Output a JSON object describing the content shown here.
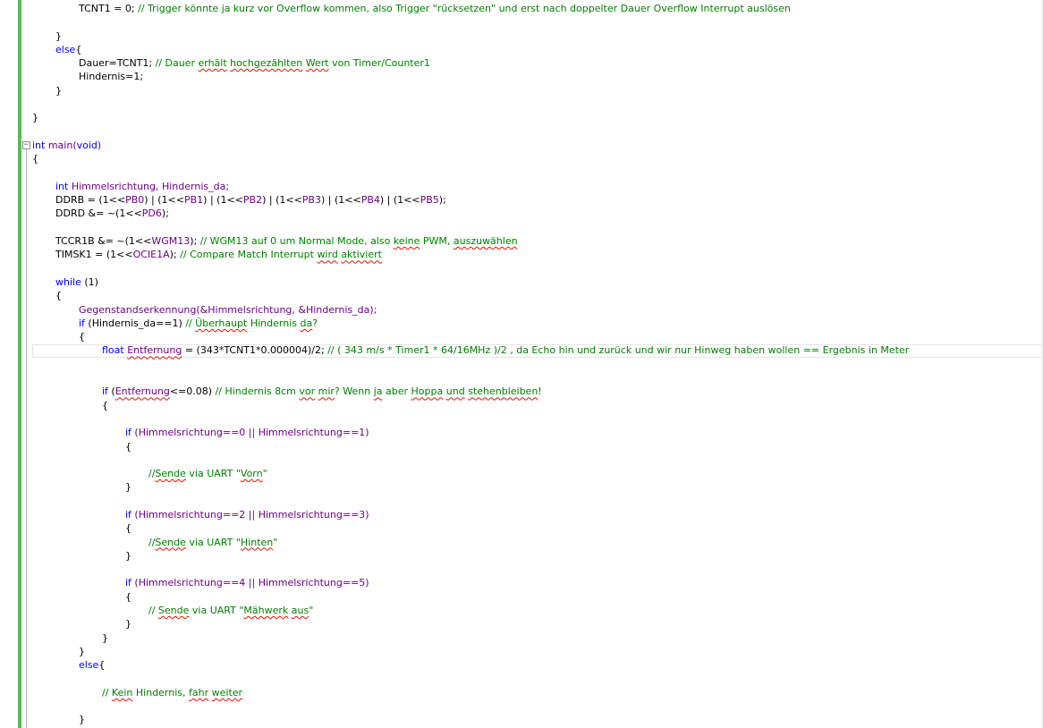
{
  "editor": {
    "collapse_glyph": "−",
    "colors": {
      "keyword": "#0000ff",
      "comment": "#008000",
      "macro": "#6f008a",
      "text": "#000000",
      "change_bar": "#5cb85c",
      "squiggle": "#e51400"
    },
    "current_line_index": 25,
    "lines": [
      {
        "indent": 4,
        "tokens": [
          {
            "t": "TCNT1 = 0; "
          },
          {
            "t": "// Trigger könnte ja kurz vor Overflow kommen, also Trigger \"rücksetzen\" und erst nach doppelter Dauer Overflow Interrupt auslösen",
            "c": "c"
          }
        ]
      },
      {
        "indent": 0,
        "tokens": []
      },
      {
        "indent": 2,
        "tokens": [
          {
            "t": "}"
          }
        ]
      },
      {
        "indent": 2,
        "tokens": [
          {
            "t": "else",
            "c": "k"
          },
          {
            "t": "{"
          }
        ]
      },
      {
        "indent": 4,
        "tokens": [
          {
            "t": "Dauer=TCNT1; "
          },
          {
            "t": "// Dauer ",
            "c": "c"
          },
          {
            "t": "erhält",
            "c": "c",
            "sq": true
          },
          {
            "t": " ",
            "c": "c"
          },
          {
            "t": "hochgezählten",
            "c": "c",
            "sq": true
          },
          {
            "t": " ",
            "c": "c"
          },
          {
            "t": "Wert",
            "c": "c",
            "sq": true
          },
          {
            "t": " von Timer/Counter1",
            "c": "c"
          }
        ]
      },
      {
        "indent": 4,
        "tokens": [
          {
            "t": "Hindernis=1;"
          }
        ]
      },
      {
        "indent": 2,
        "tokens": [
          {
            "t": "}"
          }
        ]
      },
      {
        "indent": 0,
        "tokens": []
      },
      {
        "indent": 0,
        "tokens": [
          {
            "t": "}"
          }
        ]
      },
      {
        "indent": 0,
        "tokens": []
      },
      {
        "indent": 0,
        "tokens": [
          {
            "t": "int",
            "c": "k"
          },
          {
            "t": " main(",
            "c": "m"
          },
          {
            "t": "void",
            "c": "k"
          },
          {
            "t": ")",
            "c": "m"
          }
        ]
      },
      {
        "indent": 0,
        "tokens": [
          {
            "t": "{"
          }
        ]
      },
      {
        "indent": 0,
        "tokens": []
      },
      {
        "indent": 2,
        "tokens": [
          {
            "t": "int",
            "c": "k"
          },
          {
            "t": " Himmelsrichtung, Hindernis_da;",
            "c": "m"
          }
        ]
      },
      {
        "indent": 2,
        "tokens": [
          {
            "t": "DDRB = (1<<"
          },
          {
            "t": "PB0",
            "c": "m"
          },
          {
            "t": ") | (1<<"
          },
          {
            "t": "PB1",
            "c": "m"
          },
          {
            "t": ") | (1<<"
          },
          {
            "t": "PB2",
            "c": "m"
          },
          {
            "t": ") | (1<<"
          },
          {
            "t": "PB3",
            "c": "m"
          },
          {
            "t": ") | (1<<"
          },
          {
            "t": "PB4",
            "c": "m"
          },
          {
            "t": ") | (1<<"
          },
          {
            "t": "PB5",
            "c": "m"
          },
          {
            "t": ");"
          }
        ]
      },
      {
        "indent": 2,
        "tokens": [
          {
            "t": "DDRD &= ~(1<<"
          },
          {
            "t": "PD6",
            "c": "m"
          },
          {
            "t": ");"
          }
        ]
      },
      {
        "indent": 0,
        "tokens": []
      },
      {
        "indent": 2,
        "tokens": [
          {
            "t": "TCCR1B &= ~(1<<"
          },
          {
            "t": "WGM13",
            "c": "m"
          },
          {
            "t": "); "
          },
          {
            "t": "// WGM13 auf 0 um Normal Mode, also ",
            "c": "c"
          },
          {
            "t": "keine",
            "c": "c",
            "sq": true
          },
          {
            "t": " PWM, ",
            "c": "c"
          },
          {
            "t": "auszuwählen",
            "c": "c",
            "sq": true
          }
        ]
      },
      {
        "indent": 2,
        "tokens": [
          {
            "t": "TIMSK1 = (1<<"
          },
          {
            "t": "OCIE1A",
            "c": "m"
          },
          {
            "t": "); "
          },
          {
            "t": "// Compare Match Interrupt ",
            "c": "c"
          },
          {
            "t": "wird",
            "c": "c",
            "sq": true
          },
          {
            "t": " ",
            "c": "c"
          },
          {
            "t": "aktiviert",
            "c": "c",
            "sq": true
          }
        ]
      },
      {
        "indent": 0,
        "tokens": []
      },
      {
        "indent": 2,
        "tokens": [
          {
            "t": "while",
            "c": "k"
          },
          {
            "t": " (1)"
          }
        ]
      },
      {
        "indent": 2,
        "tokens": [
          {
            "t": "{"
          }
        ]
      },
      {
        "indent": 4,
        "tokens": [
          {
            "t": "Gegenstandserkennung(&Himmelsrichtung, &Hindernis_da);",
            "c": "m"
          }
        ]
      },
      {
        "indent": 4,
        "tokens": [
          {
            "t": "if",
            "c": "k"
          },
          {
            "t": " (Hindernis_da==1) "
          },
          {
            "t": "// ",
            "c": "c"
          },
          {
            "t": "Überhaupt",
            "c": "c",
            "sq": true
          },
          {
            "t": " Hindernis ",
            "c": "c"
          },
          {
            "t": "da",
            "c": "c",
            "sq": true
          },
          {
            "t": "?",
            "c": "c"
          }
        ]
      },
      {
        "indent": 4,
        "tokens": [
          {
            "t": "{"
          }
        ]
      },
      {
        "indent": 6,
        "tokens": [
          {
            "t": "float",
            "c": "k"
          },
          {
            "t": " "
          },
          {
            "t": "Entfernung",
            "c": "m",
            "sq": true
          },
          {
            "t": " = (343*TCNT1*0.000004)/2; "
          },
          {
            "t": "// ( 343 m/s * Timer1 * 64/16MHz )/2 , da Echo hin und zurück und wir nur Hinweg haben wollen == Ergebnis in Meter",
            "c": "c"
          }
        ]
      },
      {
        "indent": 0,
        "tokens": []
      },
      {
        "indent": 0,
        "tokens": []
      },
      {
        "indent": 6,
        "tokens": [
          {
            "t": "if",
            "c": "k"
          },
          {
            "t": " ("
          },
          {
            "t": "Entfernung",
            "c": "m",
            "sq": true
          },
          {
            "t": "<=0.08) "
          },
          {
            "t": "// Hindernis 8cm ",
            "c": "c"
          },
          {
            "t": "vor",
            "c": "c",
            "sq": true
          },
          {
            "t": " ",
            "c": "c"
          },
          {
            "t": "mir",
            "c": "c",
            "sq": true
          },
          {
            "t": "? Wenn ",
            "c": "c"
          },
          {
            "t": "ja",
            "c": "c",
            "sq": true
          },
          {
            "t": " aber ",
            "c": "c"
          },
          {
            "t": "Hoppa",
            "c": "c",
            "sq": true
          },
          {
            "t": " ",
            "c": "c"
          },
          {
            "t": "und",
            "c": "c",
            "sq": true
          },
          {
            "t": " ",
            "c": "c"
          },
          {
            "t": "stehenbleiben",
            "c": "c",
            "sq": true
          },
          {
            "t": "!",
            "c": "c"
          }
        ]
      },
      {
        "indent": 6,
        "tokens": [
          {
            "t": "{"
          }
        ]
      },
      {
        "indent": 0,
        "tokens": []
      },
      {
        "indent": 8,
        "tokens": [
          {
            "t": "if",
            "c": "k"
          },
          {
            "t": " (Himmelsrichtung==0 || Himmelsrichtung==1)",
            "c": "m"
          }
        ]
      },
      {
        "indent": 8,
        "tokens": [
          {
            "t": "{"
          }
        ]
      },
      {
        "indent": 0,
        "tokens": []
      },
      {
        "indent": 10,
        "tokens": [
          {
            "t": "//",
            "c": "c"
          },
          {
            "t": "Sende",
            "c": "c",
            "sq": true
          },
          {
            "t": " via UART \"",
            "c": "c"
          },
          {
            "t": "Vorn",
            "c": "c",
            "sq": true
          },
          {
            "t": "\"",
            "c": "c"
          }
        ]
      },
      {
        "indent": 8,
        "tokens": [
          {
            "t": "}"
          }
        ]
      },
      {
        "indent": 0,
        "tokens": []
      },
      {
        "indent": 8,
        "tokens": [
          {
            "t": "if",
            "c": "k"
          },
          {
            "t": " (Himmelsrichtung==2 || Himmelsrichtung==3)",
            "c": "m"
          }
        ]
      },
      {
        "indent": 8,
        "tokens": [
          {
            "t": "{"
          }
        ]
      },
      {
        "indent": 10,
        "tokens": [
          {
            "t": "//",
            "c": "c"
          },
          {
            "t": "Sende",
            "c": "c",
            "sq": true
          },
          {
            "t": " via UART \"",
            "c": "c"
          },
          {
            "t": "Hinten",
            "c": "c",
            "sq": true
          },
          {
            "t": "\"",
            "c": "c"
          }
        ]
      },
      {
        "indent": 8,
        "tokens": [
          {
            "t": "}"
          }
        ]
      },
      {
        "indent": 0,
        "tokens": []
      },
      {
        "indent": 8,
        "tokens": [
          {
            "t": "if",
            "c": "k"
          },
          {
            "t": " (Himmelsrichtung==4 || Himmelsrichtung==5)",
            "c": "m"
          }
        ]
      },
      {
        "indent": 8,
        "tokens": [
          {
            "t": "{"
          }
        ]
      },
      {
        "indent": 10,
        "tokens": [
          {
            "t": "// ",
            "c": "c"
          },
          {
            "t": "Sende",
            "c": "c",
            "sq": true
          },
          {
            "t": " via UART \"",
            "c": "c"
          },
          {
            "t": "Mähwerk",
            "c": "c",
            "sq": true
          },
          {
            "t": " ",
            "c": "c"
          },
          {
            "t": "aus",
            "c": "c",
            "sq": true
          },
          {
            "t": "\"",
            "c": "c"
          }
        ]
      },
      {
        "indent": 8,
        "tokens": [
          {
            "t": "}"
          }
        ]
      },
      {
        "indent": 6,
        "tokens": [
          {
            "t": "}"
          }
        ]
      },
      {
        "indent": 4,
        "tokens": [
          {
            "t": "}"
          }
        ]
      },
      {
        "indent": 4,
        "tokens": [
          {
            "t": "else",
            "c": "k"
          },
          {
            "t": "{"
          }
        ]
      },
      {
        "indent": 0,
        "tokens": []
      },
      {
        "indent": 6,
        "tokens": [
          {
            "t": "// ",
            "c": "c"
          },
          {
            "t": "Kein",
            "c": "c",
            "sq": true
          },
          {
            "t": " Hindernis, ",
            "c": "c"
          },
          {
            "t": "fahr",
            "c": "c",
            "sq": true
          },
          {
            "t": " ",
            "c": "c"
          },
          {
            "t": "weiter",
            "c": "c",
            "sq": true
          }
        ]
      },
      {
        "indent": 0,
        "tokens": []
      },
      {
        "indent": 4,
        "tokens": [
          {
            "t": "}"
          }
        ]
      }
    ]
  }
}
